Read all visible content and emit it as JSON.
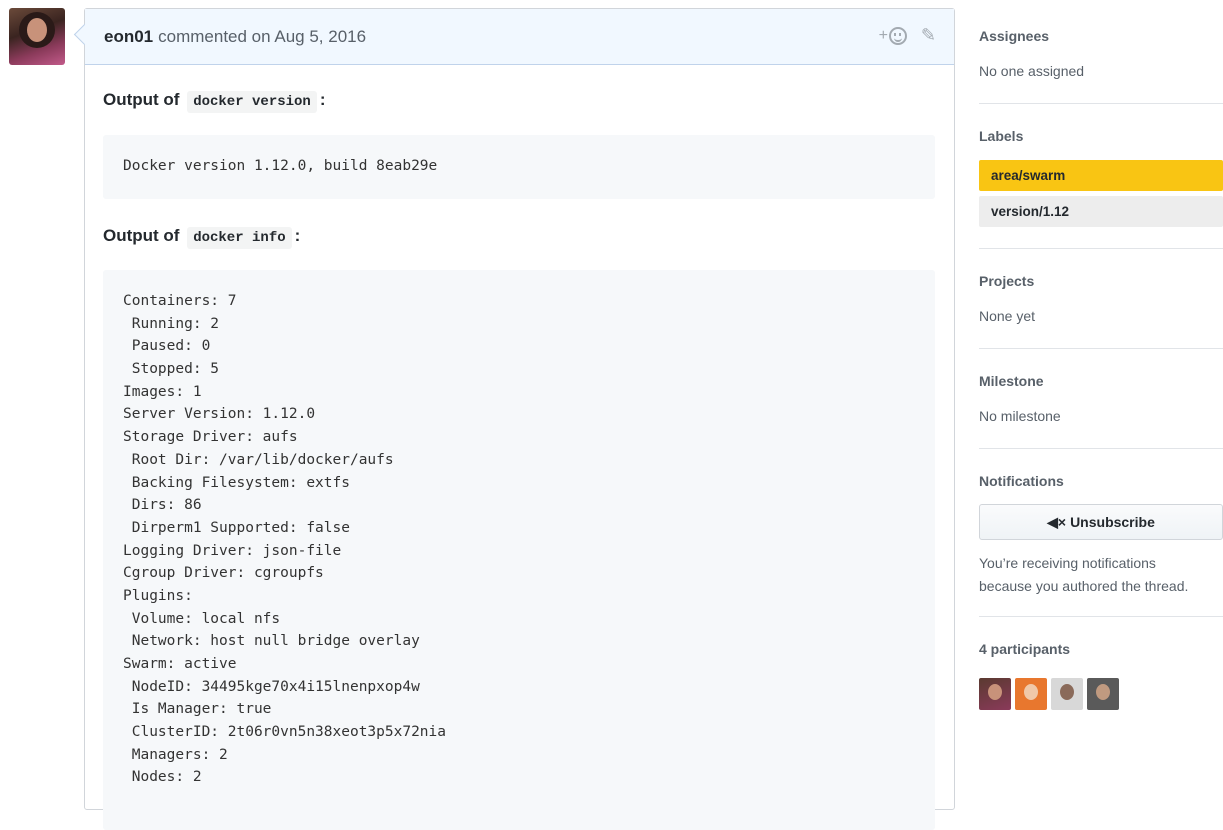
{
  "comment": {
    "author": "eon01",
    "meta": "commented on Aug 5, 2016",
    "react_plus": "+",
    "section1": {
      "prefix": "Output of",
      "code": "docker version",
      "suffix": ":"
    },
    "version_output": [
      "Docker version 1.12.0, build 8eab29e"
    ],
    "section2": {
      "prefix": "Output of",
      "code": "docker info",
      "suffix": ":"
    },
    "info_output": [
      "Containers: 7",
      " Running: 2",
      " Paused: 0",
      " Stopped: 5",
      "Images: 1",
      "Server Version: 1.12.0",
      "Storage Driver: aufs",
      " Root Dir: /var/lib/docker/aufs",
      " Backing Filesystem: extfs",
      " Dirs: 86",
      " Dirperm1 Supported: false",
      "Logging Driver: json-file",
      "Cgroup Driver: cgroupfs",
      "Plugins:",
      " Volume: local nfs",
      " Network: host null bridge overlay",
      "Swarm: active",
      " NodeID: 34495kge70x4i15lnenpxop4w",
      " Is Manager: true",
      " ClusterID: 2t06r0vn5n38xeot3p5x72nia",
      " Managers: 2",
      " Nodes: 2"
    ]
  },
  "sidebar": {
    "assignees": {
      "heading": "Assignees",
      "value": "No one assigned"
    },
    "labels": {
      "heading": "Labels",
      "items": [
        {
          "name": "area/swarm",
          "color": "#f9c513",
          "text_color": "#24292e"
        },
        {
          "name": "version/1.12",
          "color": "#ededed",
          "text_color": "#24292e"
        }
      ]
    },
    "projects": {
      "heading": "Projects",
      "value": "None yet"
    },
    "milestone": {
      "heading": "Milestone",
      "value": "No milestone"
    },
    "notifications": {
      "heading": "Notifications",
      "button": "Unsubscribe",
      "text1": "You’re receiving notifications",
      "text2": "because you authored the thread."
    },
    "participants": {
      "heading": "4 participants"
    }
  }
}
